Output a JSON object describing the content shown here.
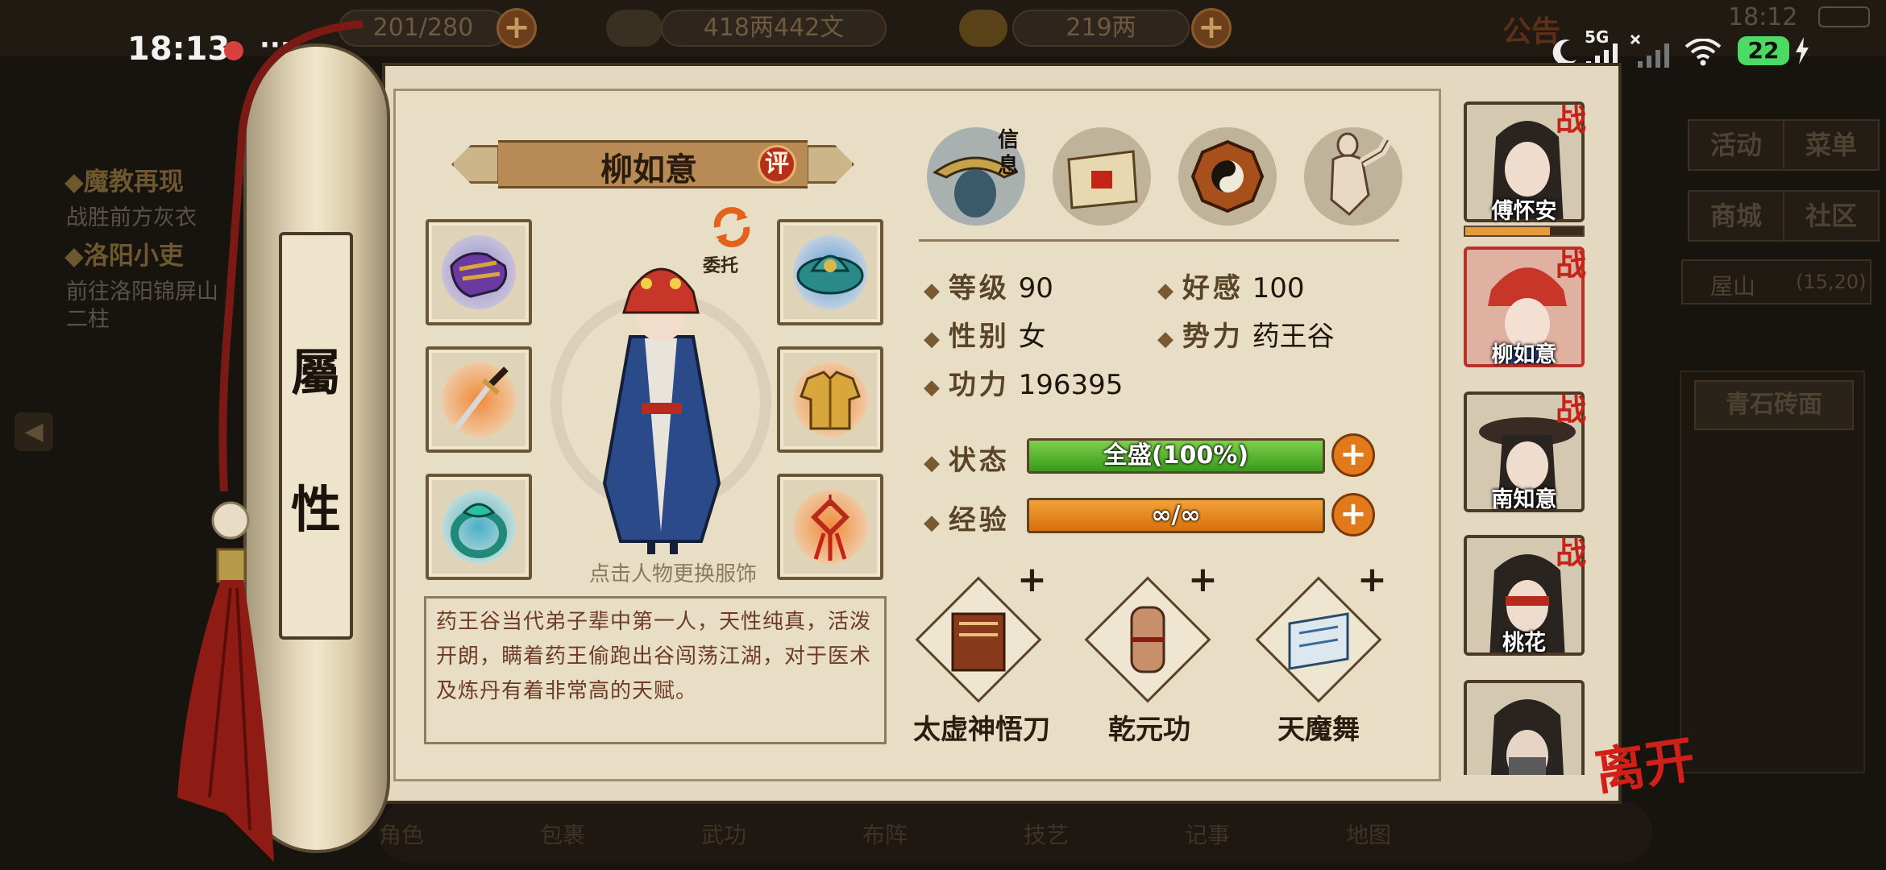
{
  "status_bar": {
    "time": "18:13",
    "dots": "···",
    "network": "5G",
    "battery": "22"
  },
  "top_bar": {
    "cap_text": "201/280",
    "silver": "418两442文",
    "gold": "219两",
    "notice": "公告",
    "game_time": "18:12"
  },
  "quests": [
    {
      "title": "◆魔教再现",
      "desc": "战胜前方灰衣"
    },
    {
      "title": "◆洛阳小吏",
      "desc": "前往洛阳锦屏山",
      "desc2": "二柱"
    }
  ],
  "side_menu": {
    "items": [
      "活动",
      "菜单",
      "商城",
      "社区"
    ],
    "location": "屋山",
    "coords": "(15,20)",
    "item_box": "青石砖面"
  },
  "bottom_menu": [
    "角色",
    "包裹",
    "武功",
    "布阵",
    "技艺",
    "记事",
    "地图"
  ],
  "panel": {
    "side_label_1": "屬",
    "side_label_2": "性",
    "character_name": "柳如意",
    "rate_badge": "评",
    "entrust_label": "委托",
    "outfit_hint": "点击人物更换服饰",
    "description": "药王谷当代弟子辈中第一人，天性纯真，活泼开朗，瞒着药王偷跑出谷闯荡江湖，对于医术及炼丹有着非常高的天赋。",
    "info_tab_label": "信息",
    "stats": {
      "level_label": "等级",
      "level": "90",
      "affinity_label": "好感",
      "affinity": "100",
      "gender_label": "性别",
      "gender": "女",
      "faction_label": "势力",
      "faction": "药王谷",
      "power_label": "功力",
      "power": "196395",
      "state_label": "状态",
      "state_value": "全盛(100%)",
      "state_fraction": 1.0,
      "exp_label": "经验",
      "exp_value": "∞/∞",
      "exp_fraction": 1.0
    },
    "skills": [
      {
        "name": "太虚神悟刀"
      },
      {
        "name": "乾元功"
      },
      {
        "name": "天魔舞"
      }
    ],
    "roster": [
      {
        "name": "傅怀安",
        "badge": "战",
        "affinity_fraction": 0.72
      },
      {
        "name": "柳如意",
        "badge": "战"
      },
      {
        "name": "南知意",
        "badge": "战"
      },
      {
        "name": "桃花",
        "badge": "战"
      }
    ],
    "leave_label": "离开"
  },
  "colors": {
    "paper": "#e4d9c0",
    "state_bar": "#5fbf3a",
    "exp_bar": "#e8871c",
    "fight_badge": "#c42417"
  }
}
